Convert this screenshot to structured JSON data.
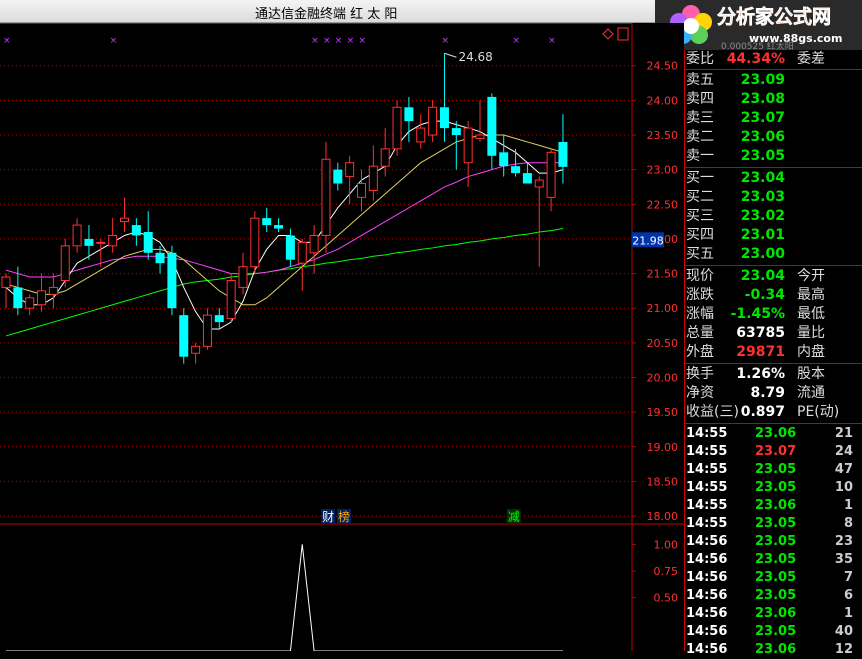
{
  "window": {
    "title": "通达信金融终端   红 太 阳"
  },
  "logo": {
    "text": "分析家公式网",
    "url": "www.88gs.com",
    "partial": "0.000525 红太阳"
  },
  "chart": {
    "max_annotation": "24.68",
    "current_price_tag": "21.98",
    "markers": [
      {
        "label": "财",
        "color": "#ffffff"
      },
      {
        "label": "榜",
        "color": "#ffaa00"
      },
      {
        "label": "减",
        "color": "#00ff00"
      }
    ],
    "colors": {
      "up": "#ff3030",
      "down": "#00ffff",
      "ma5": "#ffffff",
      "ma10": "#e0d060",
      "ma20": "#ff40ff",
      "ma60": "#00ff00",
      "grid": "#c00000"
    }
  },
  "chart_data": {
    "type": "candlestick",
    "y_ticks": [
      "24.50",
      "24.00",
      "23.50",
      "23.00",
      "22.50",
      "22.00",
      "21.50",
      "21.00",
      "20.50",
      "20.00",
      "19.50",
      "19.00",
      "18.50",
      "18.00"
    ],
    "ylim": [
      17.9,
      24.9
    ],
    "candles": [
      {
        "o": 21.3,
        "h": 21.5,
        "l": 21.0,
        "c": 21.45
      },
      {
        "o": 21.3,
        "h": 21.6,
        "l": 20.9,
        "c": 21.0
      },
      {
        "o": 21.0,
        "h": 21.2,
        "l": 20.9,
        "c": 21.15
      },
      {
        "o": 21.05,
        "h": 21.5,
        "l": 20.95,
        "c": 21.25
      },
      {
        "o": 21.2,
        "h": 21.5,
        "l": 21.0,
        "c": 21.3
      },
      {
        "o": 21.4,
        "h": 22.0,
        "l": 21.3,
        "c": 21.9
      },
      {
        "o": 21.9,
        "h": 22.3,
        "l": 21.8,
        "c": 22.2
      },
      {
        "o": 22.0,
        "h": 22.2,
        "l": 21.7,
        "c": 21.9
      },
      {
        "o": 21.95,
        "h": 22.0,
        "l": 21.6,
        "c": 21.95
      },
      {
        "o": 21.9,
        "h": 22.3,
        "l": 21.8,
        "c": 22.05
      },
      {
        "o": 22.25,
        "h": 22.6,
        "l": 22.1,
        "c": 22.3
      },
      {
        "o": 22.2,
        "h": 22.3,
        "l": 21.9,
        "c": 22.05
      },
      {
        "o": 22.1,
        "h": 22.4,
        "l": 21.7,
        "c": 21.8
      },
      {
        "o": 21.8,
        "h": 21.9,
        "l": 21.5,
        "c": 21.65
      },
      {
        "o": 21.8,
        "h": 21.9,
        "l": 20.9,
        "c": 21.0
      },
      {
        "o": 20.9,
        "h": 21.0,
        "l": 20.2,
        "c": 20.3
      },
      {
        "o": 20.35,
        "h": 20.5,
        "l": 20.2,
        "c": 20.45
      },
      {
        "o": 20.45,
        "h": 21.0,
        "l": 20.4,
        "c": 20.9
      },
      {
        "o": 20.9,
        "h": 21.0,
        "l": 20.7,
        "c": 20.8
      },
      {
        "o": 20.85,
        "h": 21.5,
        "l": 20.8,
        "c": 21.4
      },
      {
        "o": 21.3,
        "h": 21.8,
        "l": 21.2,
        "c": 21.6
      },
      {
        "o": 21.6,
        "h": 22.4,
        "l": 21.5,
        "c": 22.3
      },
      {
        "o": 22.3,
        "h": 22.45,
        "l": 22.1,
        "c": 22.2
      },
      {
        "o": 22.2,
        "h": 22.3,
        "l": 22.1,
        "c": 22.15
      },
      {
        "o": 22.05,
        "h": 22.15,
        "l": 21.6,
        "c": 21.7
      },
      {
        "o": 21.65,
        "h": 22.0,
        "l": 21.25,
        "c": 21.95
      },
      {
        "o": 21.8,
        "h": 22.2,
        "l": 21.5,
        "c": 22.05
      },
      {
        "o": 22.05,
        "h": 23.4,
        "l": 21.8,
        "c": 23.15
      },
      {
        "o": 23.0,
        "h": 23.1,
        "l": 22.7,
        "c": 22.8
      },
      {
        "o": 22.9,
        "h": 23.2,
        "l": 22.5,
        "c": 23.1
      },
      {
        "o": 22.6,
        "h": 23.0,
        "l": 22.4,
        "c": 22.8
      },
      {
        "o": 22.7,
        "h": 23.35,
        "l": 22.55,
        "c": 23.05
      },
      {
        "o": 23.05,
        "h": 23.6,
        "l": 22.9,
        "c": 23.3
      },
      {
        "o": 23.3,
        "h": 24.0,
        "l": 23.2,
        "c": 23.9
      },
      {
        "o": 23.9,
        "h": 24.05,
        "l": 23.4,
        "c": 23.7
      },
      {
        "o": 23.4,
        "h": 23.8,
        "l": 23.3,
        "c": 23.6
      },
      {
        "o": 23.5,
        "h": 24.0,
        "l": 23.4,
        "c": 23.9
      },
      {
        "o": 23.9,
        "h": 24.68,
        "l": 23.4,
        "c": 23.6
      },
      {
        "o": 23.6,
        "h": 23.7,
        "l": 23.0,
        "c": 23.5
      },
      {
        "o": 23.1,
        "h": 23.7,
        "l": 22.75,
        "c": 23.6
      },
      {
        "o": 23.45,
        "h": 24.0,
        "l": 23.4,
        "c": 23.5
      },
      {
        "o": 24.05,
        "h": 24.1,
        "l": 23.0,
        "c": 23.2
      },
      {
        "o": 23.25,
        "h": 23.5,
        "l": 22.9,
        "c": 23.05
      },
      {
        "o": 23.05,
        "h": 23.3,
        "l": 22.9,
        "c": 22.95
      },
      {
        "o": 22.95,
        "h": 23.1,
        "l": 22.8,
        "c": 22.8
      },
      {
        "o": 22.75,
        "h": 22.9,
        "l": 21.6,
        "c": 22.85
      },
      {
        "o": 22.6,
        "h": 23.3,
        "l": 22.4,
        "c": 23.25
      },
      {
        "o": 23.4,
        "h": 23.8,
        "l": 22.8,
        "c": 23.04
      }
    ],
    "ma5": [
      21.3,
      21.15,
      21.05,
      21.05,
      21.15,
      21.4,
      21.65,
      21.75,
      21.85,
      21.95,
      22.05,
      22.1,
      22.05,
      21.95,
      21.7,
      21.3,
      20.95,
      20.7,
      20.7,
      20.8,
      21.1,
      21.55,
      21.85,
      22.05,
      22.05,
      21.95,
      21.95,
      22.2,
      22.45,
      22.65,
      22.85,
      22.95,
      23.05,
      23.35,
      23.55,
      23.65,
      23.7,
      23.7,
      23.65,
      23.6,
      23.55,
      23.45,
      23.35,
      23.25,
      23.1,
      22.95,
      22.95,
      23.0
    ],
    "ma10": [
      21.35,
      21.3,
      21.25,
      21.2,
      21.2,
      21.25,
      21.35,
      21.45,
      21.55,
      21.65,
      21.75,
      21.8,
      21.85,
      21.85,
      21.8,
      21.7,
      21.55,
      21.4,
      21.25,
      21.15,
      21.05,
      21.05,
      21.15,
      21.3,
      21.45,
      21.6,
      21.75,
      21.9,
      22.05,
      22.2,
      22.35,
      22.5,
      22.65,
      22.8,
      22.95,
      23.1,
      23.2,
      23.3,
      23.4,
      23.45,
      23.5,
      23.5,
      23.5,
      23.45,
      23.4,
      23.35,
      23.3,
      23.25
    ],
    "ma20": [
      21.55,
      21.5,
      21.45,
      21.45,
      21.45,
      21.5,
      21.55,
      21.6,
      21.65,
      21.7,
      21.72,
      21.75,
      21.75,
      21.75,
      21.72,
      21.7,
      21.65,
      21.6,
      21.55,
      21.5,
      21.5,
      21.5,
      21.52,
      21.55,
      21.6,
      21.65,
      21.7,
      21.78,
      21.85,
      21.95,
      22.05,
      22.15,
      22.25,
      22.35,
      22.45,
      22.55,
      22.65,
      22.75,
      22.82,
      22.9,
      22.95,
      23.0,
      23.05,
      23.08,
      23.1,
      23.1,
      23.1,
      23.1
    ],
    "ma60": [
      20.6,
      20.65,
      20.7,
      20.75,
      20.8,
      20.85,
      20.9,
      20.95,
      21.0,
      21.05,
      21.1,
      21.15,
      21.2,
      21.25,
      21.3,
      21.35,
      21.38,
      21.4,
      21.42,
      21.45,
      21.47,
      21.5,
      21.52,
      21.55,
      21.57,
      21.6,
      21.62,
      21.65,
      21.67,
      21.7,
      21.72,
      21.75,
      21.77,
      21.8,
      21.82,
      21.85,
      21.87,
      21.9,
      21.92,
      21.95,
      21.97,
      22.0,
      22.02,
      22.05,
      22.07,
      22.1,
      22.12,
      22.15
    ],
    "sub_y_ticks": [
      "1.00",
      "0.75",
      "0.50"
    ],
    "sub_ylim": [
      0,
      1.05
    ],
    "sub_values": [
      0,
      0,
      0,
      0,
      0,
      0,
      0,
      0,
      0,
      0,
      0,
      0,
      0,
      0,
      0,
      0,
      0,
      0,
      0,
      0,
      0,
      0,
      0,
      0,
      0,
      1,
      0,
      0,
      0,
      0,
      0,
      0,
      0,
      0,
      0,
      0,
      0,
      0,
      0,
      0,
      0,
      0,
      0,
      0,
      0,
      0,
      0,
      0
    ]
  },
  "quote": {
    "weibi": {
      "label": "委比",
      "value": "44.34%",
      "label2": "委差"
    },
    "asks": [
      {
        "label": "卖五",
        "price": "23.09"
      },
      {
        "label": "卖四",
        "price": "23.08"
      },
      {
        "label": "卖三",
        "price": "23.07"
      },
      {
        "label": "卖二",
        "price": "23.06"
      },
      {
        "label": "卖一",
        "price": "23.05"
      }
    ],
    "bids": [
      {
        "label": "买一",
        "price": "23.04"
      },
      {
        "label": "买二",
        "price": "23.03"
      },
      {
        "label": "买三",
        "price": "23.02"
      },
      {
        "label": "买四",
        "price": "23.01"
      },
      {
        "label": "买五",
        "price": "23.00"
      }
    ],
    "stats1": [
      {
        "label": "现价",
        "value": "23.04",
        "label2": "今开",
        "color": "green"
      },
      {
        "label": "涨跌",
        "value": "-0.34",
        "label2": "最高",
        "color": "green"
      },
      {
        "label": "涨幅",
        "value": "-1.45%",
        "label2": "最低",
        "color": "green"
      },
      {
        "label": "总量",
        "value": "63785",
        "label2": "量比",
        "color": "white"
      },
      {
        "label": "外盘",
        "value": "29871",
        "label2": "内盘",
        "color": "red"
      }
    ],
    "stats2": [
      {
        "label": "换手",
        "value": "1.26%",
        "label2": "股本"
      },
      {
        "label": "净资",
        "value": "8.79",
        "label2": "流通"
      },
      {
        "label": "收益(三)",
        "value": "0.897",
        "label2": "PE(动)"
      }
    ],
    "ticks": [
      {
        "time": "14:55",
        "price": "23.06",
        "vol": "21",
        "color": "green"
      },
      {
        "time": "14:55",
        "price": "23.07",
        "vol": "24",
        "color": "red"
      },
      {
        "time": "14:55",
        "price": "23.05",
        "vol": "47",
        "color": "green"
      },
      {
        "time": "14:55",
        "price": "23.05",
        "vol": "10",
        "color": "green"
      },
      {
        "time": "14:55",
        "price": "23.06",
        "vol": "1",
        "color": "green"
      },
      {
        "time": "14:55",
        "price": "23.05",
        "vol": "8",
        "color": "green"
      },
      {
        "time": "14:56",
        "price": "23.05",
        "vol": "23",
        "color": "green"
      },
      {
        "time": "14:56",
        "price": "23.05",
        "vol": "35",
        "color": "green"
      },
      {
        "time": "14:56",
        "price": "23.05",
        "vol": "7",
        "color": "green"
      },
      {
        "time": "14:56",
        "price": "23.05",
        "vol": "6",
        "color": "green"
      },
      {
        "time": "14:56",
        "price": "23.06",
        "vol": "1",
        "color": "green"
      },
      {
        "time": "14:56",
        "price": "23.05",
        "vol": "40",
        "color": "green"
      },
      {
        "time": "14:56",
        "price": "23.06",
        "vol": "12",
        "color": "green"
      }
    ]
  }
}
